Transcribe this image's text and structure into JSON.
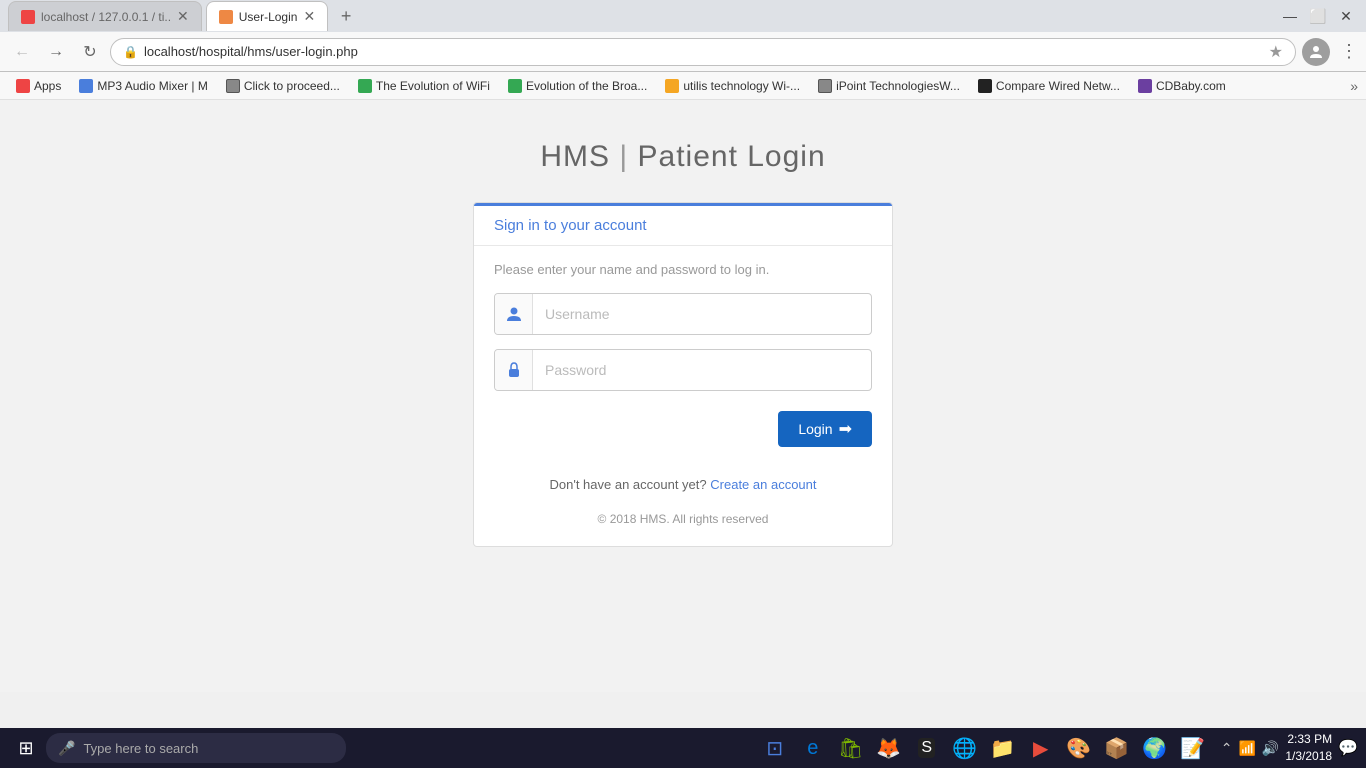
{
  "browser": {
    "tabs": [
      {
        "id": "tab1",
        "favicon_color": "red",
        "title": "localhost / 127.0.0.1 / ti...",
        "active": false
      },
      {
        "id": "tab2",
        "favicon_color": "orange",
        "title": "User-Login",
        "active": true
      }
    ],
    "url": "localhost/hospital/hms/user-login.php",
    "url_full": "localhost/hospital/hms/user-login.php"
  },
  "bookmarks": [
    {
      "id": "apps",
      "label": "Apps",
      "color": "bm-red"
    },
    {
      "id": "mp3",
      "label": "MP3 Audio Mixer | M",
      "color": "bm-blue"
    },
    {
      "id": "click",
      "label": "Click to proceed...",
      "color": "bm-gray"
    },
    {
      "id": "wifi1",
      "label": "The Evolution of WiFi",
      "color": "bm-green"
    },
    {
      "id": "broads",
      "label": "Evolution of the Broa...",
      "color": "bm-green"
    },
    {
      "id": "utilis",
      "label": "utilis technology Wi-...",
      "color": "bm-orange"
    },
    {
      "id": "ipoint",
      "label": "iPoint TechnologiesW...",
      "color": "bm-gray"
    },
    {
      "id": "compare",
      "label": "Compare Wired Netw...",
      "color": "bm-dark"
    },
    {
      "id": "cdbaby",
      "label": "CDBaby.com",
      "color": "bm-purple"
    }
  ],
  "page": {
    "title_part1": "HMS",
    "title_pipe": "|",
    "title_part2": "Patient Login",
    "form": {
      "sign_in_label": "Sign in to your account",
      "description": "Please enter your name and password to log in.",
      "username_placeholder": "Username",
      "password_placeholder": "Password",
      "login_button": "Login",
      "no_account_text": "Don't have an account yet?",
      "create_account_link": "Create an account"
    },
    "footer": "© 2018 HMS. All rights reserved"
  },
  "taskbar": {
    "search_placeholder": "Type here to search",
    "time": "2:33 PM",
    "date": "1/3/2018"
  }
}
